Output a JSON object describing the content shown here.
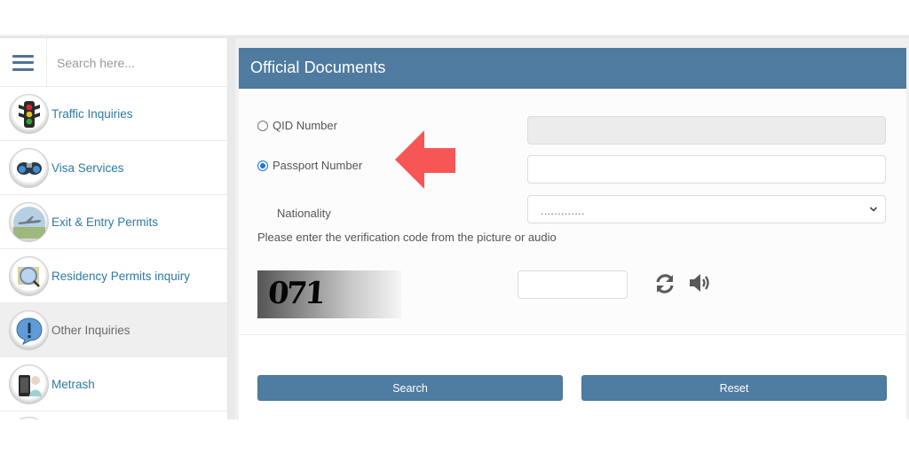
{
  "sidebar": {
    "menu_icon": "hamburger-menu-icon",
    "search": {
      "placeholder": "Search here...",
      "value": ""
    },
    "items": [
      {
        "label": "Traffic Inquiries",
        "icon": "traffic-light-icon",
        "active": false
      },
      {
        "label": "Visa Services",
        "icon": "visa-binoculars-icon",
        "active": false
      },
      {
        "label": "Exit & Entry Permits",
        "icon": "airplane-icon",
        "active": false
      },
      {
        "label": "Residency Permits inquiry",
        "icon": "magnifier-document-icon",
        "active": false
      },
      {
        "label": "Other Inquiries",
        "icon": "exclamation-bubble-icon",
        "active": true
      },
      {
        "label": "Metrash",
        "icon": "metrash-phone-icon",
        "active": false
      }
    ]
  },
  "panel": {
    "title": "Official Documents",
    "form": {
      "id_type_options": [
        {
          "label": "QID Number",
          "checked": false
        },
        {
          "label": "Passport Number",
          "checked": true
        }
      ],
      "qid_field": {
        "value": "",
        "disabled": true
      },
      "passport_field": {
        "value": ""
      },
      "nationality": {
        "label": "Nationality",
        "selected": "............."
      },
      "verification_instruction": "Please enter the verification code from the picture or audio",
      "captcha": {
        "code": "071"
      },
      "captcha_input": {
        "value": ""
      },
      "refresh_icon": "refresh-icon",
      "audio_icon": "speaker-icon"
    },
    "buttons": {
      "search": "Search",
      "reset": "Reset"
    }
  },
  "annotation": {
    "arrow_color": "#f85656",
    "arrow_direction": "left"
  },
  "colors": {
    "header": "#507ba0",
    "button": "#4f7ca1",
    "link": "#2d7aa3"
  }
}
